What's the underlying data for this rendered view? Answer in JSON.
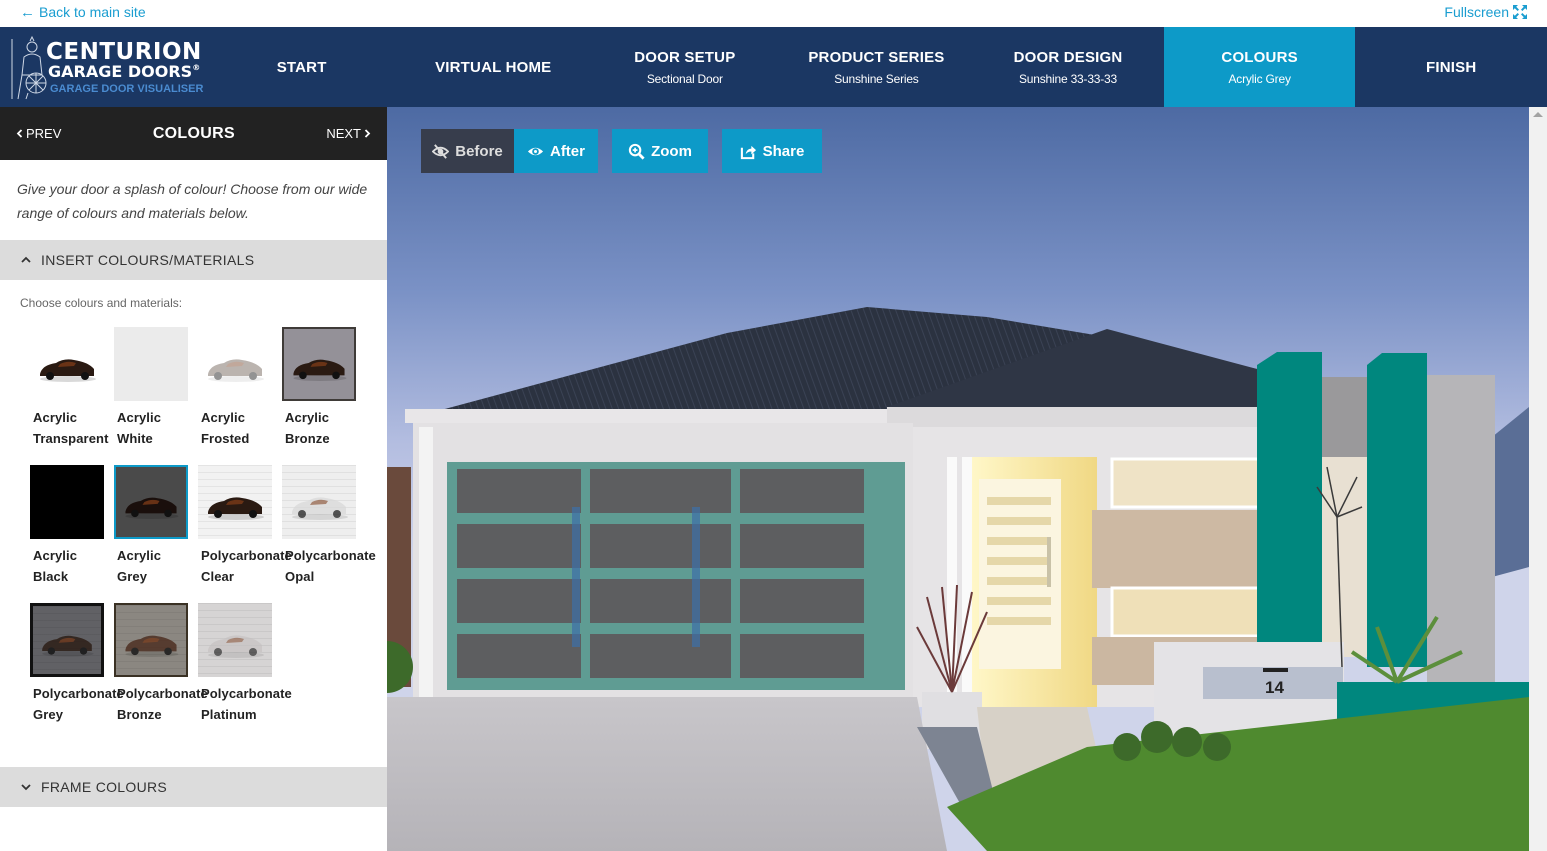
{
  "topbar": {
    "back_label": "Back to main site",
    "back_icon": "arrow-left-icon",
    "fullscreen_label": "Fullscreen",
    "fullscreen_icon": "expand-arrows-icon"
  },
  "logo": {
    "line1": "CENTURION",
    "line2": "GARAGE DOORS",
    "registered": "®",
    "line3": "GARAGE DOOR VISUALISER"
  },
  "nav": {
    "items": [
      {
        "title": "START",
        "sub": ""
      },
      {
        "title": "VIRTUAL HOME",
        "sub": ""
      },
      {
        "title": "DOOR SETUP",
        "sub": "Sectional Door"
      },
      {
        "title": "PRODUCT SERIES",
        "sub": "Sunshine Series"
      },
      {
        "title": "DOOR DESIGN",
        "sub": "Sunshine 33-33-33"
      },
      {
        "title": "COLOURS",
        "sub": "Acrylic Grey",
        "active": true
      },
      {
        "title": "FINISH",
        "sub": ""
      }
    ]
  },
  "sidebar": {
    "prev_label": "PREV",
    "next_label": "NEXT",
    "title": "COLOURS",
    "intro": "Give your door a splash of colour! Choose from our wide range of colours and materials below.",
    "insert_section": {
      "label": "INSERT COLOURS/MATERIALS",
      "expanded": true,
      "choose_label": "Choose colours and materials:",
      "materials": [
        {
          "line1": "Acrylic",
          "line2": "Transparent",
          "selected": false
        },
        {
          "line1": "Acrylic",
          "line2": "White",
          "selected": false
        },
        {
          "line1": "Acrylic",
          "line2": "Frosted",
          "selected": false
        },
        {
          "line1": "Acrylic",
          "line2": "Bronze",
          "selected": false
        },
        {
          "line1": "Acrylic",
          "line2": "Black",
          "selected": false
        },
        {
          "line1": "Acrylic",
          "line2": "Grey",
          "selected": true
        },
        {
          "line1": "Polycarbonate",
          "line2": "Clear",
          "selected": false
        },
        {
          "line1": "Polycarbonate",
          "line2": "Opal",
          "selected": false
        },
        {
          "line1": "Polycarbonate",
          "line2": "Grey",
          "selected": false
        },
        {
          "line1": "Polycarbonate",
          "line2": "Bronze",
          "selected": false
        },
        {
          "line1": "Polycarbonate",
          "line2": "Platinum",
          "selected": false
        }
      ]
    },
    "frame_section": {
      "label": "FRAME COLOURS",
      "expanded": false
    }
  },
  "viewer": {
    "before_label": "Before",
    "after_label": "After",
    "zoom_label": "Zoom",
    "share_label": "Share",
    "active_view": "After",
    "house_number": "14"
  },
  "colors": {
    "nav_bg": "#1b3763",
    "accent": "#0d9ac8",
    "sidebar_header": "#222222",
    "section_header": "#dcdcdc",
    "before_btn": "#373d4c",
    "door_frame": "#5f9c93",
    "feature_wall": "#00877e"
  }
}
